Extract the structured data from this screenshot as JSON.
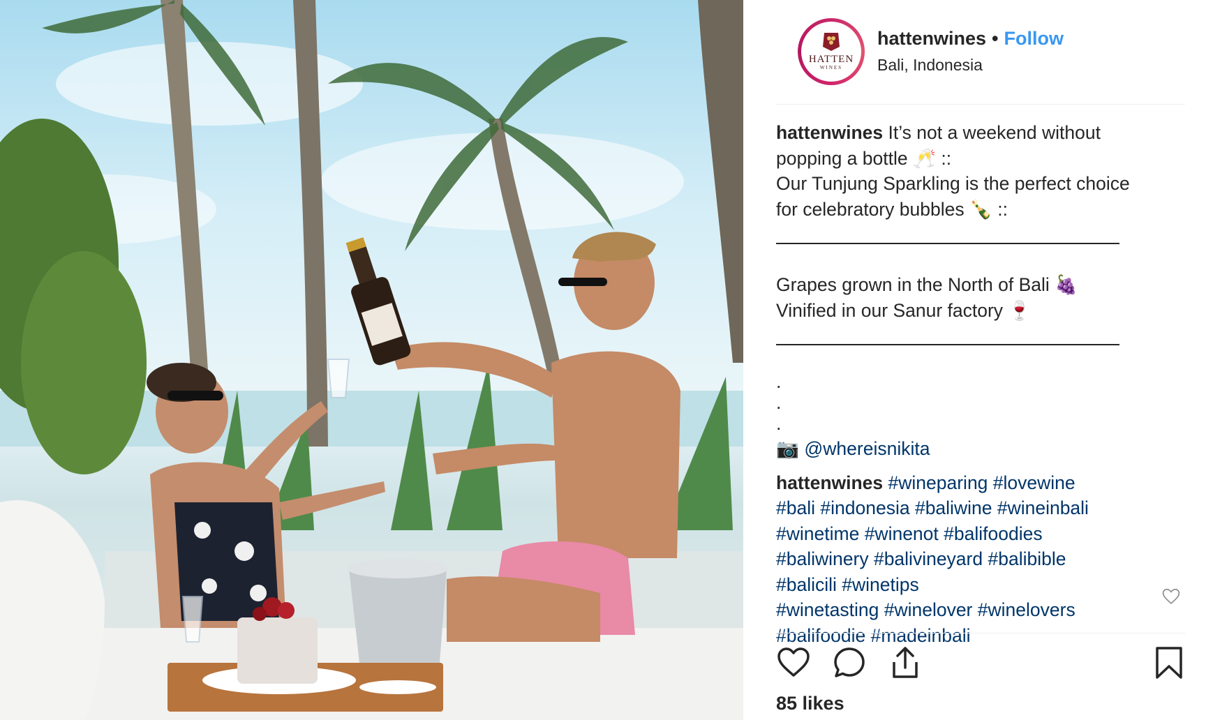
{
  "post": {
    "username": "hattenwines",
    "separator": "•",
    "follow_label": "Follow",
    "location": "Bali, Indonesia",
    "avatar_text": "HATTEN",
    "avatar_subtext": "WINES"
  },
  "caption": {
    "line1_text": " It’s not a weekend without",
    "line2": "popping a bottle 🥂 ::",
    "line3": "Our Tunjung Sparkling is the perfect choice",
    "line4": "for celebratory bubbles 🍾 ::",
    "line5": "Grapes grown in the North of Bali 🍇",
    "line6": "Vinified in our Sanur factory 🍷",
    "dots": [
      ".",
      ".",
      "."
    ],
    "camera_icon_glyph": "📷",
    "mention": "@whereisnikita"
  },
  "comment": {
    "username": "hattenwines",
    "hashtag_lines": [
      [
        "#wineparing",
        "#lovewine"
      ],
      [
        "#bali",
        "#indonesia",
        "#baliwine",
        "#wineinbali"
      ],
      [
        "#winetime",
        "#winenot",
        "#balifoodies"
      ],
      [
        "#baliwinery",
        "#balivineyard",
        "#balibible"
      ],
      [
        "#balicili",
        "#winetips"
      ],
      [
        "#winetasting",
        "#winelover",
        "#winelovers"
      ],
      [
        "#balifoodie",
        "#madeinbali"
      ]
    ]
  },
  "actions": {
    "like_icon": "heart-icon",
    "comment_icon": "comment-bubble-icon",
    "share_icon": "share-icon",
    "save_icon": "bookmark-icon"
  },
  "likes": "85 likes",
  "colors": {
    "link_blue": "#3897f0",
    "hashtag_navy": "#003569",
    "text": "#262626",
    "avatar_ring": "#c9276b"
  }
}
